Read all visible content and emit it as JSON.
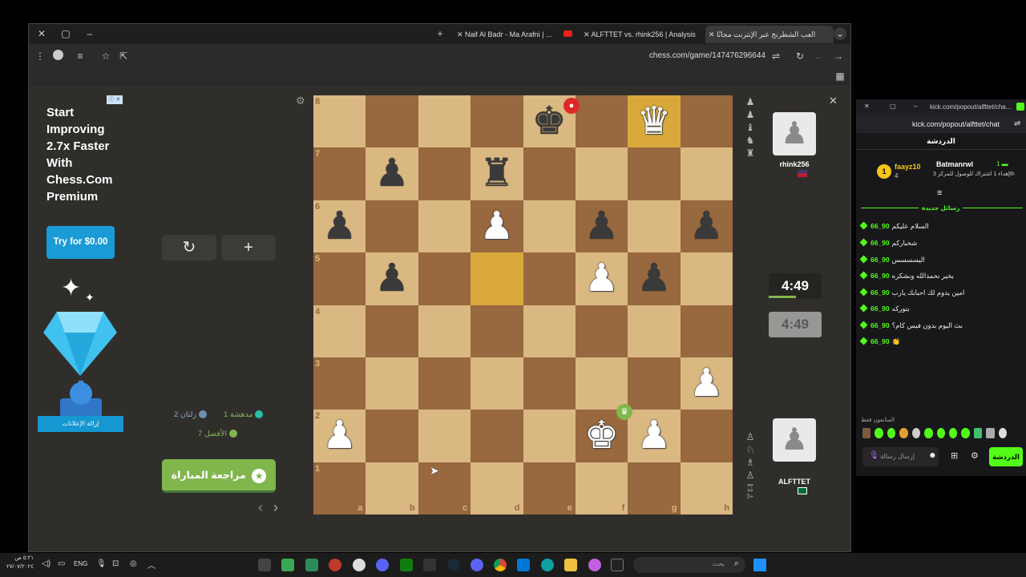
{
  "tabs": [
    {
      "label": "Naif Al Badr - Ma Arafni | ..."
    },
    {
      "label": "ALFTTET vs. rhink256 | Analysis"
    },
    {
      "label": "العب الشطرنج عبر الإنترنت مجانًا"
    }
  ],
  "address": {
    "url": "chess.com/game/147476296644"
  },
  "ad": {
    "title": "Start Improving 2.7x Faster With Chess.Com Premium",
    "try_button": "Try for $0.00",
    "remove_ads": "إزالة الإعلانات"
  },
  "controls": {
    "rotate_icon": "↻",
    "add_icon": "+"
  },
  "stats": {
    "brilliant": "1 مدهشة",
    "mistakes": "2 زلتان",
    "best": "7 الأفضل"
  },
  "review_button": "مراجعة المباراة",
  "nav": {
    "prev": "‹",
    "next": "›"
  },
  "board": {
    "ranks": [
      "8",
      "7",
      "6",
      "5",
      "4",
      "3",
      "2",
      "1"
    ],
    "files": [
      "a",
      "b",
      "c",
      "d",
      "e",
      "f",
      "g",
      "h"
    ],
    "pieces": {
      "e8": "k",
      "g8": "Q",
      "b7": "p",
      "d7": "r",
      "a6": "p",
      "d6": "P",
      "f6": "p",
      "h6": "p",
      "b5": "p",
      "f5": "P",
      "g5": "p",
      "h3": "P",
      "a2": "P",
      "f2": "K",
      "g2": "P"
    },
    "highlights": [
      "g8",
      "d5"
    ],
    "glyphs": {
      "K": "♚",
      "Q": "♛",
      "R": "♜",
      "B": "♝",
      "N": "♞",
      "P": "♟",
      "k": "♚",
      "q": "♛",
      "r": "♜",
      "b": "♝",
      "n": "♞",
      "p": "♟"
    }
  },
  "players": {
    "top": {
      "name": "rhink256",
      "clock": "4:49"
    },
    "bottom": {
      "name": "ALFTTET",
      "clock": "4:49"
    }
  },
  "kick": {
    "header_url": "kick.com/popout/alfttet/cha...",
    "url": "kick.com/popout/alfttet/chat",
    "tab_title": "الدردشة",
    "pinned_user": "Batmanrwl",
    "pinned_text": "إهداء 1 اشتراك للوصول للمركز 3th",
    "gifter": "faayz10",
    "gifter_count": "4",
    "new_messages": "رسائل جديدة",
    "messages": [
      {
        "user": "66_90",
        "text": "السلام عليكم"
      },
      {
        "user": "66_90",
        "text": "شخباركم"
      },
      {
        "user": "66_90",
        "text": "اليسسسس"
      },
      {
        "user": "66_90",
        "text": "بخير نحمدالله ونشكره"
      },
      {
        "user": "66_90",
        "text": "امين يدوم لك احبابك يارب"
      },
      {
        "user": "66_90",
        "text": "بتوركه"
      },
      {
        "user": "66_90",
        "text": "بث اليوم بدون فيس كام؟"
      },
      {
        "user": "66_90",
        "text": "👏"
      }
    ],
    "chatters_label": "المتابعون فقط",
    "input_placeholder": "إرسال رسالة",
    "chat_button": "الدردشة"
  },
  "taskbar": {
    "lang": "ENG",
    "time": "٥:٢١ ص",
    "date": "٢٧/٠٧/٢٠٢٤",
    "search_placeholder": "بحث"
  }
}
